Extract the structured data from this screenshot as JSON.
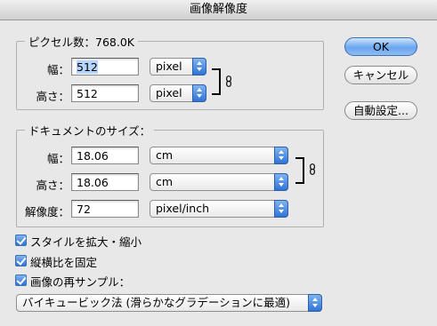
{
  "window": {
    "title": "画像解像度"
  },
  "pixel_dimensions": {
    "legend": "ピクセル数：768.0K",
    "width_label": "幅：",
    "width_value": "512",
    "width_unit": "pixel",
    "height_label": "高さ：",
    "height_value": "512",
    "height_unit": "pixel"
  },
  "document_size": {
    "legend": "ドキュメントのサイズ：",
    "width_label": "幅：",
    "width_value": "18.06",
    "width_unit": "cm",
    "height_label": "高さ：",
    "height_value": "18.06",
    "height_unit": "cm",
    "resolution_label": "解像度：",
    "resolution_value": "72",
    "resolution_unit": "pixel/inch"
  },
  "options": {
    "scale_styles": {
      "label": "スタイルを拡大・縮小",
      "checked": true
    },
    "constrain_proportions": {
      "label": "縦横比を固定",
      "checked": true
    },
    "resample_image": {
      "label": "画像の再サンプル：",
      "checked": true
    },
    "resample_method": "バイキュービック法 (滑らかなグラデーションに最適)"
  },
  "buttons": {
    "ok": "OK",
    "cancel": "キャンセル",
    "auto": "自動設定..."
  },
  "colors": {
    "accent": "#2f74d6",
    "background": "#e8e8e8"
  }
}
